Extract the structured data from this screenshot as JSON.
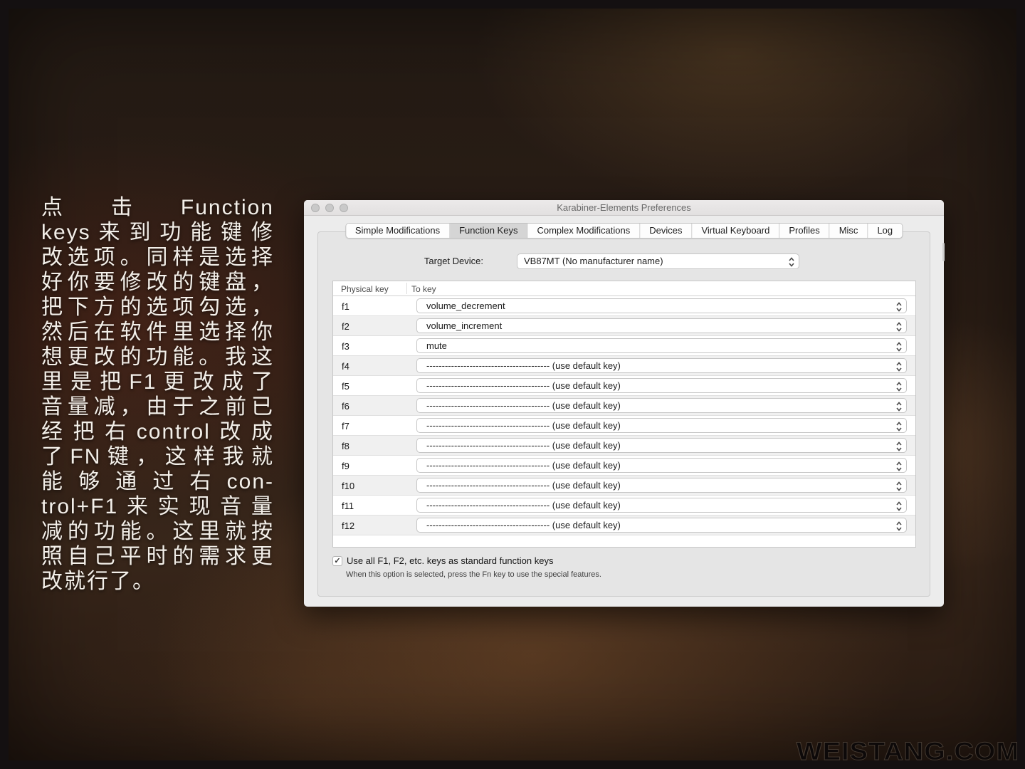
{
  "background": {
    "caption": {
      "lines": [
        "点击Function",
        "keys来到功能键修",
        "改选项。同样是选择",
        "好你要修改的键盘，",
        "把下方的选项勾选，",
        "然后在软件里选择你",
        "想更改的功能。我这",
        "里是把F1更改成了",
        "音量减，由于之前已",
        "经把右control改成",
        "了FN键，这样我就",
        "能够通过右con-",
        "trol+F1来实现音量",
        "减的功能。这里就按",
        "照自己平时的需求更",
        "改就行了。"
      ]
    },
    "watermark": "WEISTANG.COM"
  },
  "window": {
    "title": "Karabiner-Elements Preferences",
    "tabs": [
      {
        "label": "Simple Modifications",
        "selected": false
      },
      {
        "label": "Function Keys",
        "selected": true
      },
      {
        "label": "Complex Modifications",
        "selected": false
      },
      {
        "label": "Devices",
        "selected": false
      },
      {
        "label": "Virtual Keyboard",
        "selected": false
      },
      {
        "label": "Profiles",
        "selected": false
      },
      {
        "label": "Misc",
        "selected": false
      },
      {
        "label": "Log",
        "selected": false
      }
    ],
    "target_device": {
      "label": "Target Device:",
      "value": "VB87MT (No manufacturer name)"
    },
    "table": {
      "columns": [
        "Physical key",
        "To key"
      ],
      "rows": [
        {
          "key": "f1",
          "value": "volume_decrement"
        },
        {
          "key": "f2",
          "value": "volume_increment"
        },
        {
          "key": "f3",
          "value": "mute"
        },
        {
          "key": "f4",
          "value": "---------------------------------------- (use default key)"
        },
        {
          "key": "f5",
          "value": "---------------------------------------- (use default key)"
        },
        {
          "key": "f6",
          "value": "---------------------------------------- (use default key)"
        },
        {
          "key": "f7",
          "value": "---------------------------------------- (use default key)"
        },
        {
          "key": "f8",
          "value": "---------------------------------------- (use default key)"
        },
        {
          "key": "f9",
          "value": "---------------------------------------- (use default key)"
        },
        {
          "key": "f10",
          "value": "---------------------------------------- (use default key)"
        },
        {
          "key": "f11",
          "value": "---------------------------------------- (use default key)"
        },
        {
          "key": "f12",
          "value": "---------------------------------------- (use default key)"
        }
      ]
    },
    "checkbox": {
      "checked": true,
      "check_glyph": "✓",
      "label": "Use all F1, F2, etc. keys as standard function keys",
      "hint": "When this option is selected, press the Fn key to use the special features."
    },
    "colors": {
      "window_bg": "#ececec",
      "panel_bg": "#e5e5e5",
      "selected_tab_bg": "#d5d5d5",
      "row_alt_bg": "#f0f0f0"
    }
  }
}
